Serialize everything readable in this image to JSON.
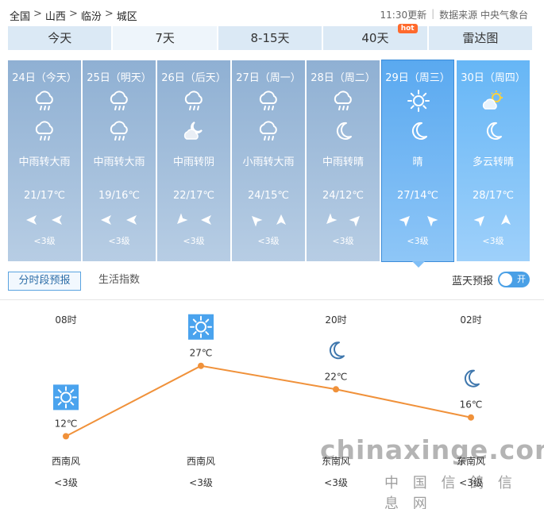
{
  "breadcrumb": [
    "全国",
    "山西",
    "临汾",
    "城区"
  ],
  "breadcrumb_sep": ">",
  "update_time": "11:30更新",
  "source": "数据来源 中央气象台",
  "tabs": [
    {
      "label": "今天"
    },
    {
      "label": "7天",
      "active": true
    },
    {
      "label": "8-15天"
    },
    {
      "label": "40天",
      "badge": "hot"
    },
    {
      "label": "雷达图"
    }
  ],
  "days": [
    {
      "date": "24日（今天）",
      "icon_day": "rain-icon",
      "icon_night": "rain-icon",
      "weather": "中雨转大雨",
      "temp": "21/17℃",
      "wind_dirs": [
        "west-arrow",
        "west-arrow"
      ],
      "wind_level": "<3级"
    },
    {
      "date": "25日（明天）",
      "icon_day": "rain-icon",
      "icon_night": "rain-icon",
      "weather": "中雨转大雨",
      "temp": "19/16℃",
      "wind_dirs": [
        "west-arrow",
        "west-arrow"
      ],
      "wind_level": "<3级"
    },
    {
      "date": "26日（后天）",
      "icon_day": "rain-icon",
      "icon_night": "cloudy-night-icon",
      "weather": "中雨转阴",
      "temp": "22/17℃",
      "wind_dirs": [
        "southwest-arrow",
        "west-arrow"
      ],
      "wind_level": "<3级"
    },
    {
      "date": "27日（周一）",
      "icon_day": "rain-icon",
      "icon_night": "rain-icon",
      "weather": "小雨转大雨",
      "temp": "24/15℃",
      "wind_dirs": [
        "northwest-arrow",
        "north-arrow"
      ],
      "wind_level": "<3级"
    },
    {
      "date": "28日（周二）",
      "icon_day": "rain-icon",
      "icon_night": "moon-icon",
      "weather": "中雨转晴",
      "temp": "24/12℃",
      "wind_dirs": [
        "southwest-arrow",
        "northeast-arrow"
      ],
      "wind_level": "<3级"
    },
    {
      "date": "29日（周三）",
      "icon_day": "sun-icon",
      "icon_night": "moon-icon",
      "weather": "晴",
      "temp": "27/14℃",
      "wind_dirs": [
        "northeast-arrow",
        "northwest-arrow"
      ],
      "wind_level": "<3级",
      "selected": true
    },
    {
      "date": "30日（周四）",
      "icon_day": "partly-cloudy-icon",
      "icon_night": "moon-icon",
      "weather": "多云转晴",
      "temp": "28/17℃",
      "wind_dirs": [
        "northeast-arrow",
        "north-arrow"
      ],
      "wind_level": "<3级"
    }
  ],
  "subtabs": {
    "active": "分时段预报",
    "other": "生活指数"
  },
  "bluesky": {
    "label": "蓝天预报",
    "toggle_text": "开"
  },
  "chart_data": {
    "type": "line",
    "categories": [
      "08时",
      "14时",
      "20时",
      "02时"
    ],
    "series": [
      {
        "values": [
          12,
          27,
          22,
          16
        ]
      }
    ],
    "value_labels": [
      "12℃",
      "27℃",
      "22℃",
      "16℃"
    ],
    "icons": [
      "sun-icon",
      "sun-icon",
      "moon-icon",
      "moon-icon"
    ],
    "wind_dir": [
      "西南风",
      "西南风",
      "东南风",
      "东南风"
    ],
    "wind_level": [
      "<3级",
      "<3级",
      "<3级",
      "<3级"
    ],
    "line_color": "#f0913a",
    "ylim": [
      8,
      30
    ]
  },
  "watermark": {
    "domain": "chinaxinge.com",
    "name": "中 国 信 鸽 信 息 网"
  }
}
